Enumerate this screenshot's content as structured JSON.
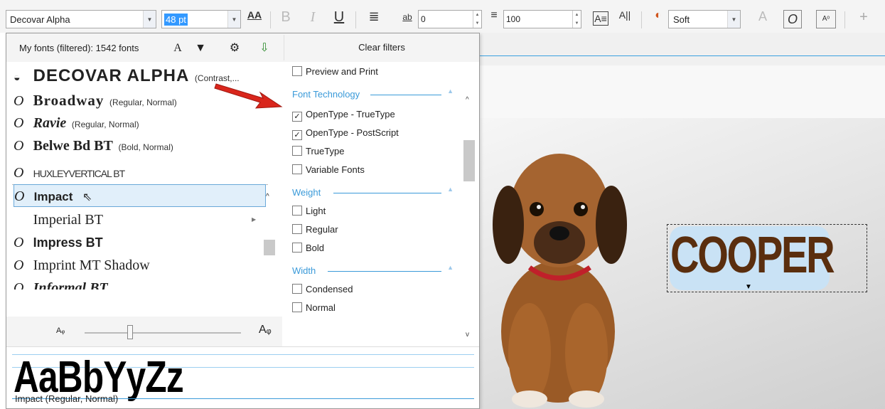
{
  "toolbar": {
    "font_name": "Decovar Alpha",
    "font_size": "48 pt",
    "char_spacing": "0",
    "line_spacing": "100",
    "style_select": "Soft",
    "icons": [
      "font-size-adjust-icon",
      "bold-icon",
      "italic-icon",
      "underline-icon",
      "align-icon",
      "char-spacing-icon",
      "line-spacing-icon",
      "columns-icon",
      "case-icon",
      "variable-icon",
      "outline-font-icon",
      "italic-o-icon",
      "font-settings-icon",
      "add-icon"
    ]
  },
  "panel": {
    "filter_count": "My fonts (filtered): 1542 fonts",
    "clear_filters": "Clear filters",
    "header_icons": [
      "font-recognize-icon",
      "filter-icon",
      "settings-icon",
      "install-font-icon"
    ]
  },
  "fonts": [
    {
      "name": "DECOVAR ALPHA",
      "sub": "(Contrast,..."
    },
    {
      "name": "Broadway",
      "sub": "(Regular, Normal)"
    },
    {
      "name": "Ravie",
      "sub": "(Regular, Normal)"
    },
    {
      "name": "Belwe Bd BT",
      "sub": "(Bold, Normal)"
    },
    {
      "name": "HUXLEYVERTICAL BT",
      "sub": ""
    },
    {
      "name": "Impact",
      "sub": ""
    },
    {
      "name": "Imperial BT",
      "sub": ""
    },
    {
      "name": "Impress BT",
      "sub": ""
    },
    {
      "name": "Imprint MT Shadow",
      "sub": ""
    },
    {
      "name": "Informal BT",
      "sub": ""
    }
  ],
  "filters": {
    "preview_print": "Preview and Print",
    "tech_header": "Font Technology",
    "tech": [
      {
        "label": "OpenType - TrueType",
        "checked": "✓"
      },
      {
        "label": "OpenType - PostScript",
        "checked": "✓"
      },
      {
        "label": "TrueType",
        "checked": ""
      },
      {
        "label": "Variable Fonts",
        "checked": ""
      }
    ],
    "weight_header": "Weight",
    "weight": [
      {
        "label": "Light",
        "checked": ""
      },
      {
        "label": "Regular",
        "checked": ""
      },
      {
        "label": "Bold",
        "checked": ""
      }
    ],
    "width_header": "Width",
    "width": [
      {
        "label": "Condensed",
        "checked": ""
      },
      {
        "label": "Normal",
        "checked": ""
      }
    ]
  },
  "preview": {
    "sample": "AaBbYyZz",
    "font_desc": "Impact (Regular, Normal)"
  },
  "canvas": {
    "text": "COOPER"
  },
  "colors": {
    "accent": "#3a9ad9",
    "selection_bg": "#e1effa",
    "cooper_text": "#5a2e0e",
    "cooper_bg": "#c9e2f5",
    "arrow": "#d9261c"
  }
}
